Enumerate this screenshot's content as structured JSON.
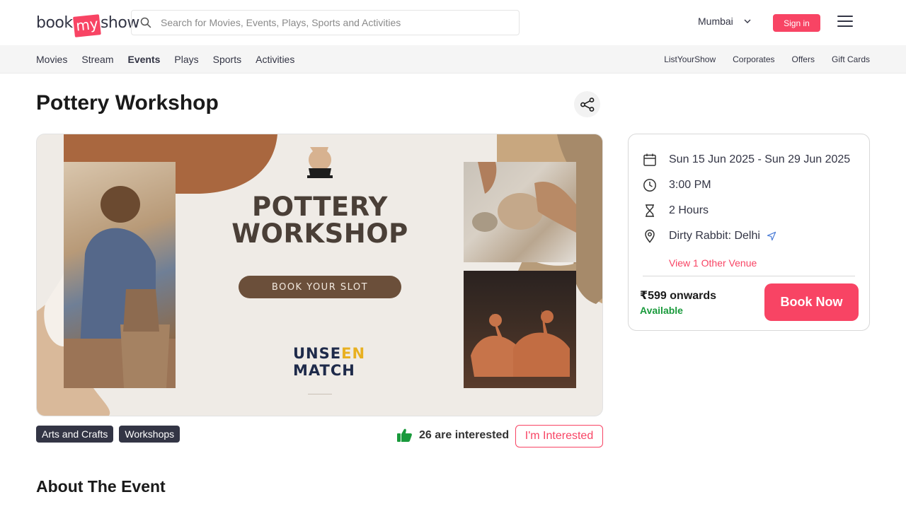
{
  "header": {
    "logo": {
      "part1": "book",
      "part2": "my",
      "part3": "show"
    },
    "search_placeholder": "Search for Movies, Events, Plays, Sports and Activities",
    "city": "Mumbai",
    "signin_label": "Sign in"
  },
  "subnav": {
    "left": [
      "Movies",
      "Stream",
      "Events",
      "Plays",
      "Sports",
      "Activities"
    ],
    "active": "Events",
    "right": [
      "ListYourShow",
      "Corporates",
      "Offers",
      "Gift Cards"
    ]
  },
  "event": {
    "title": "Pottery Workshop",
    "banner": {
      "title_line1": "POTTERY",
      "title_line2": "WORKSHOP",
      "button": "BOOK YOUR SLOT",
      "brand_line1a": "UNSE",
      "brand_line1b": "EN",
      "brand_line2": "MATCH"
    },
    "tags": [
      "Arts and Crafts",
      "Workshops"
    ],
    "interested_text": "26 are interested",
    "interested_button": "I'm Interested",
    "about_heading": "About The Event"
  },
  "card": {
    "date": "Sun 15 Jun 2025 - Sun 29 Jun 2025",
    "time": "3:00 PM",
    "duration": "2 Hours",
    "venue": "Dirty Rabbit: Delhi",
    "other_venue": "View 1 Other Venue",
    "price": "₹599 onwards",
    "availability": "Available",
    "book_label": "Book Now"
  },
  "colors": {
    "brand": "#f84464",
    "dark": "#333545",
    "available": "#1a9a3c"
  },
  "icons": [
    "search-icon",
    "chevron-down-icon",
    "hamburger-menu-icon",
    "share-icon",
    "calendar-icon",
    "clock-icon",
    "hourglass-icon",
    "location-pin-icon",
    "navigate-icon",
    "thumbs-up-icon"
  ]
}
